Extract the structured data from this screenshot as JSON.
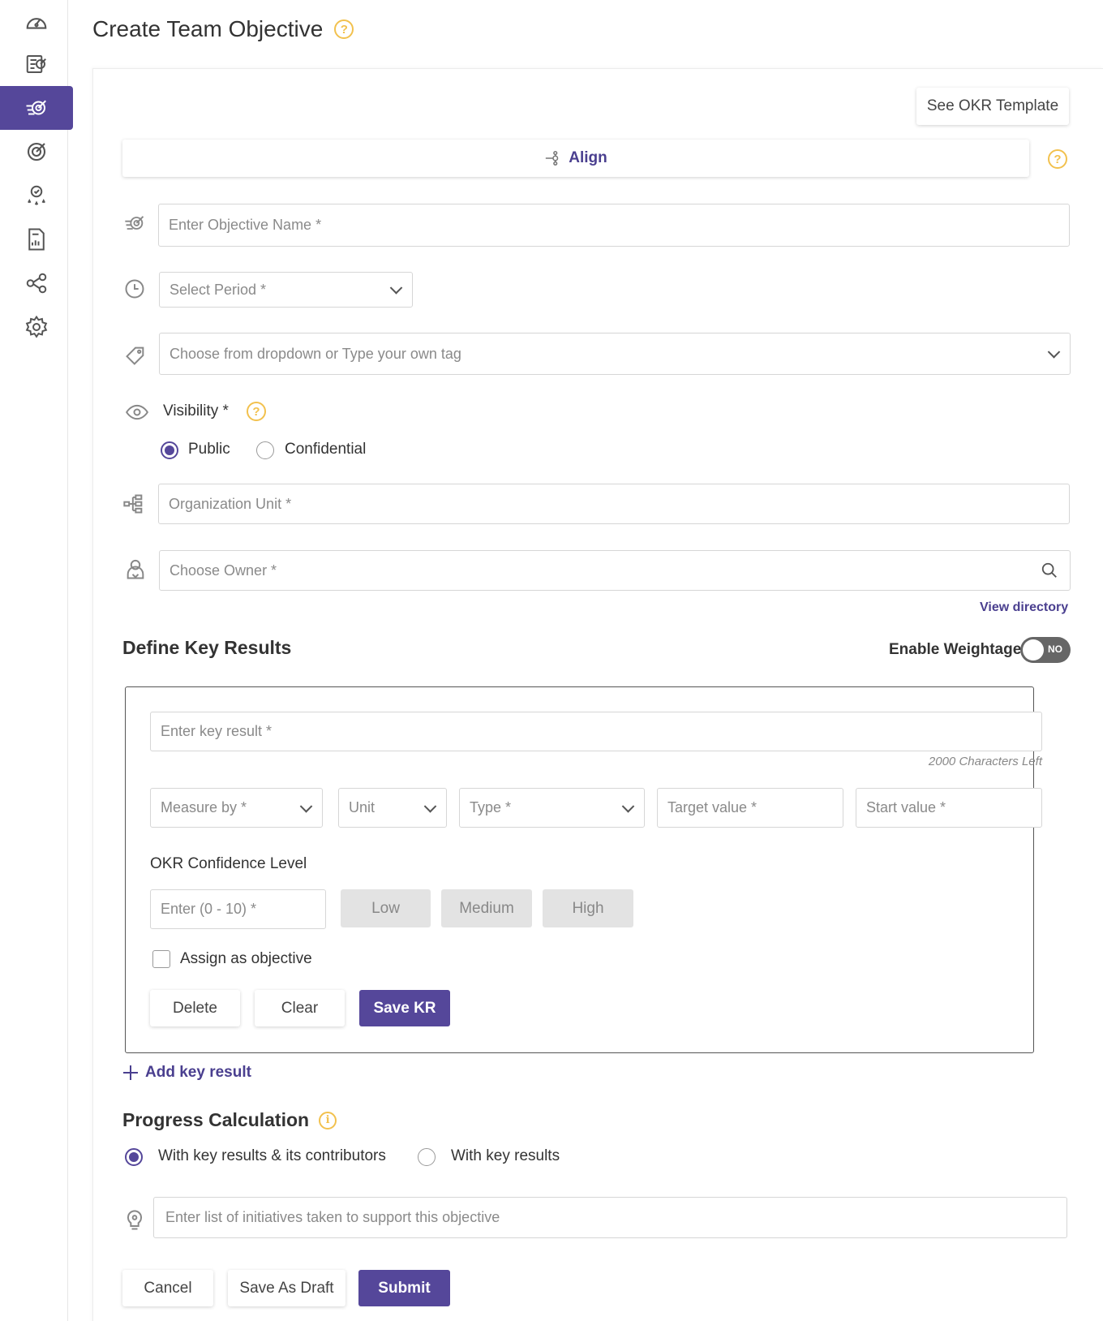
{
  "page": {
    "title": "Create Team Objective"
  },
  "toolbar": {
    "okr_template_label": "See OKR Template",
    "align_label": "Align"
  },
  "objective": {
    "name_placeholder": "Enter Objective Name *",
    "period_placeholder": "Select Period *",
    "tag_placeholder": "Choose from dropdown or Type your own tag",
    "visibility_label": "Visibility *",
    "visibility_options": [
      "Public",
      "Confidential"
    ],
    "visibility_selected": "Public",
    "org_unit_placeholder": "Organization Unit *",
    "owner_placeholder": "Choose Owner *",
    "view_directory_label": "View directory"
  },
  "key_results": {
    "heading": "Define Key Results",
    "weightage_label": "Enable Weightage",
    "weightage_toggle": "NO",
    "kr_placeholder": "Enter key result *",
    "chars_left": "2000 Characters Left",
    "measure_by": "Measure by *",
    "unit": "Unit",
    "type": "Type *",
    "target_value": "Target value *",
    "start_value": "Start value *",
    "confidence_label": "OKR Confidence Level",
    "confidence_placeholder": "Enter (0 - 10) *",
    "confidence_levels": [
      "Low",
      "Medium",
      "High"
    ],
    "assign_label": "Assign as objective",
    "delete_label": "Delete",
    "clear_label": "Clear",
    "save_label": "Save KR",
    "add_label": "Add key result"
  },
  "progress": {
    "heading": "Progress Calculation",
    "options": [
      "With key results & its contributors",
      "With key results"
    ],
    "selected": "With key results & its contributors",
    "initiatives_placeholder": "Enter list of initiatives taken to support this objective"
  },
  "actions": {
    "cancel_label": "Cancel",
    "draft_label": "Save As Draft",
    "submit_label": "Submit"
  },
  "colors": {
    "accent": "#55479a",
    "help": "#f2c14e"
  },
  "icons": [
    "dashboard-icon",
    "objectives-icon",
    "team-objective-icon",
    "target-icon",
    "badge-icon",
    "report-icon",
    "share-nodes-icon",
    "gear-icon"
  ]
}
